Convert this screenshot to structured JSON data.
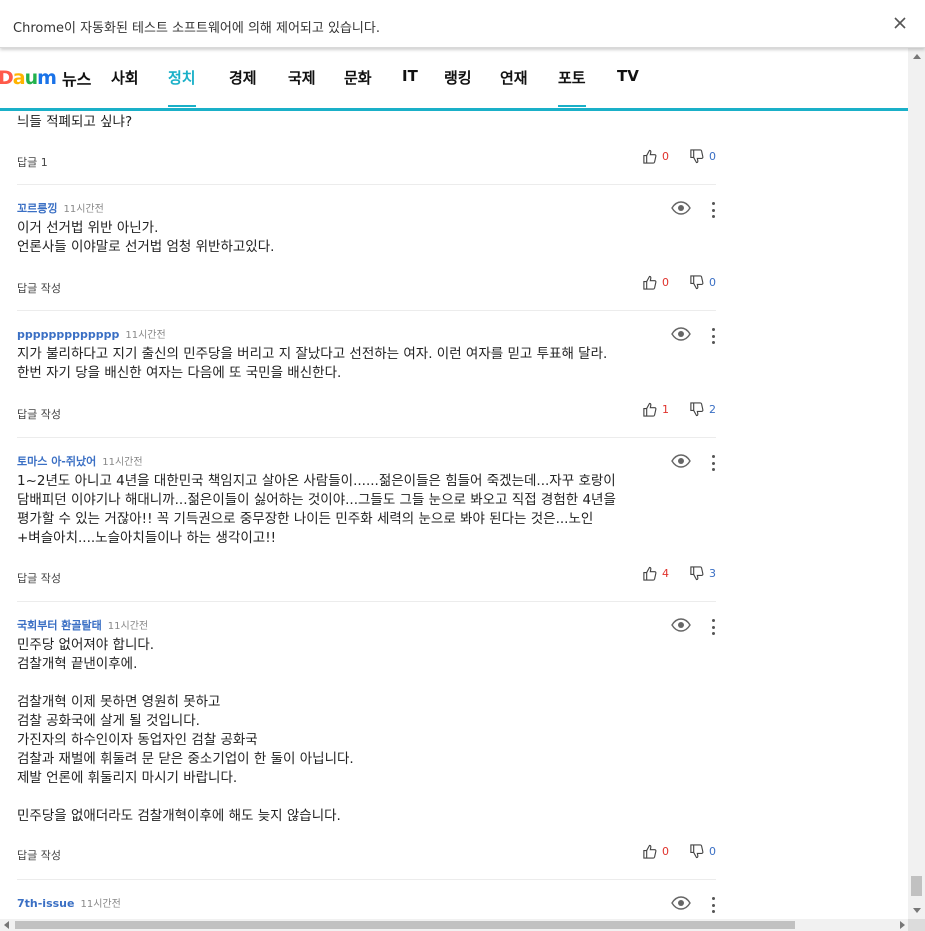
{
  "infobar": {
    "message": "Chrome이 자동화된 테스트 소프트웨어에 의해 제어되고 있습니다."
  },
  "header": {
    "logo_text": "Daum",
    "logo_colors": [
      "#ff5a4a",
      "#ffb400",
      "#22b14c",
      "#1a73e8",
      "#ff5a4a"
    ],
    "section_title": "뉴스",
    "nav": [
      "사회",
      "정치",
      "경제",
      "국제",
      "문화",
      "IT",
      "랭킹",
      "연재",
      "포토",
      "TV"
    ],
    "active_tab": "정치",
    "accent_color": "#1ab0c8"
  },
  "comments": [
    {
      "author": "",
      "time": "",
      "body": "늬들 적폐되고 싶냐?",
      "reply_label": "답글 1",
      "likes": "0",
      "dislikes": "0"
    },
    {
      "author": "꼬르릉낑",
      "time": "11시간전",
      "body": "이거 선거법 위반 아닌가.\n언론사들 이야말로 선거법 엄청 위반하고있다.",
      "reply_label": "답글 작성",
      "likes": "0",
      "dislikes": "0"
    },
    {
      "author": "ppppppppppppp",
      "time": "11시간전",
      "body": "지가 불리하다고 지기 출신의 민주당을 버리고 지 잘났다고 선전하는 여자. 이런 여자를 믿고 투표해 달라.\n한번 자기 당을 배신한 여자는 다음에 또 국민을 배신한다.",
      "reply_label": "답글 작성",
      "likes": "1",
      "dislikes": "2"
    },
    {
      "author": "토마스 아-쥐났어",
      "time": "11시간전",
      "body": "1~2년도 아니고 4년을 대한민국 책임지고 살아온 사람들이......젊은이들은 힘들어 죽겠는데...자꾸 호랑이\n담배피던 이야기나 해대니까...젊은이들이 싫어하는 것이야...그들도 그들 눈으로 봐오고 직접 경험한 4년을\n평가할 수 있는 거잖아!! 꼭 기득권으로 중무장한 나이든 민주화 세력의 눈으로 봐야 된다는 것은...노인\n+벼슬아치....노슬아치들이나 하는 생각이고!!",
      "reply_label": "답글 작성",
      "likes": "4",
      "dislikes": "3"
    },
    {
      "author": "국회부터 환골탈태",
      "time": "11시간전",
      "body": "민주당 없어져야 합니다.\n검찰개혁 끝낸이후에.\n\n검찰개혁 이제 못하면 영원히 못하고\n검찰 공화국에 살게 될 것입니다.\n가진자의 하수인이자 동업자인 검찰 공화국\n검찰과 재벌에  휘둘려 문 닫은 중소기업이 한 둘이 아닙니다.\n제발 언론에 휘둘리지 마시기 바랍니다.\n\n민주당을 없애더라도 검찰개혁이후에 해도 늦지 않습니다.",
      "reply_label": "답글 작성",
      "likes": "0",
      "dislikes": "0"
    },
    {
      "author": "7th-issue",
      "time": "11시간전",
      "body": "",
      "reply_label": "",
      "likes": "",
      "dislikes": ""
    }
  ]
}
